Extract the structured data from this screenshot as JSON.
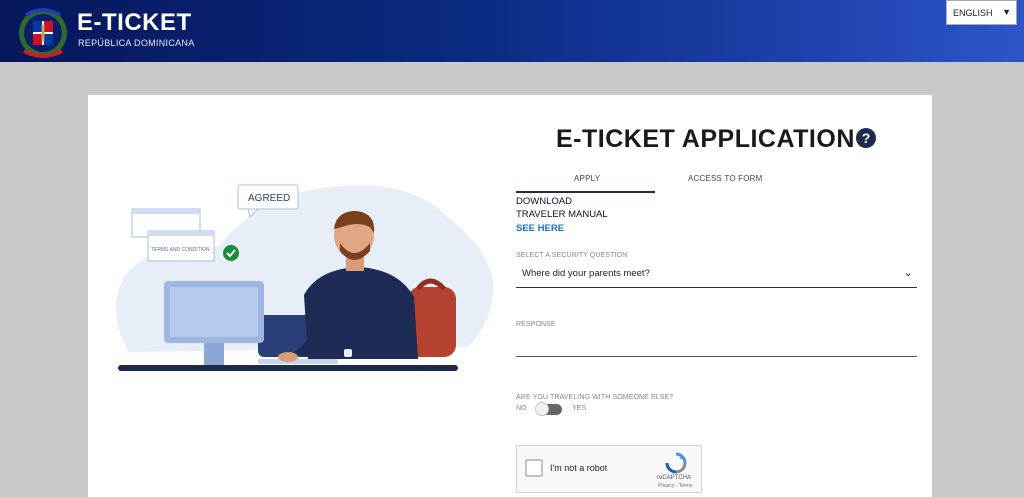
{
  "header": {
    "title": "E-TICKET",
    "subtitle": "REPÚBLICA DOMINICANA",
    "language": "ENGLISH"
  },
  "illustration": {
    "bubble_text": "AGREED",
    "card_text": "TERMS AND CONDITION"
  },
  "form": {
    "title": "E-TICKET APPLICATION",
    "help_symbol": "?",
    "tabs": [
      {
        "label": "APPLY",
        "active": true
      },
      {
        "label": "ACCESS TO FORM",
        "active": false
      }
    ],
    "download_label": "DOWNLOAD",
    "manual_label": "TRAVELER MANUAL",
    "see_here_label": "SEE HERE",
    "security_question_label": "SELECT A SECURITY QUESTION",
    "security_question_value": "Where did your parents meet?",
    "response_label": "RESPONSE",
    "response_value": "",
    "traveling_label": "ARE YOU TRAVELING WITH SOMEONE ELSE?",
    "toggle_no": "NO",
    "toggle_yes": "YES",
    "toggle_on": false
  },
  "recaptcha": {
    "label": "I'm not a robot",
    "brand": "reCAPTCHA",
    "terms": "Privacy - Terms"
  },
  "colors": {
    "header_start": "#06165a",
    "header_end": "#2c56c8",
    "accent": "#1d2b4f",
    "link": "#1a6fc9"
  }
}
